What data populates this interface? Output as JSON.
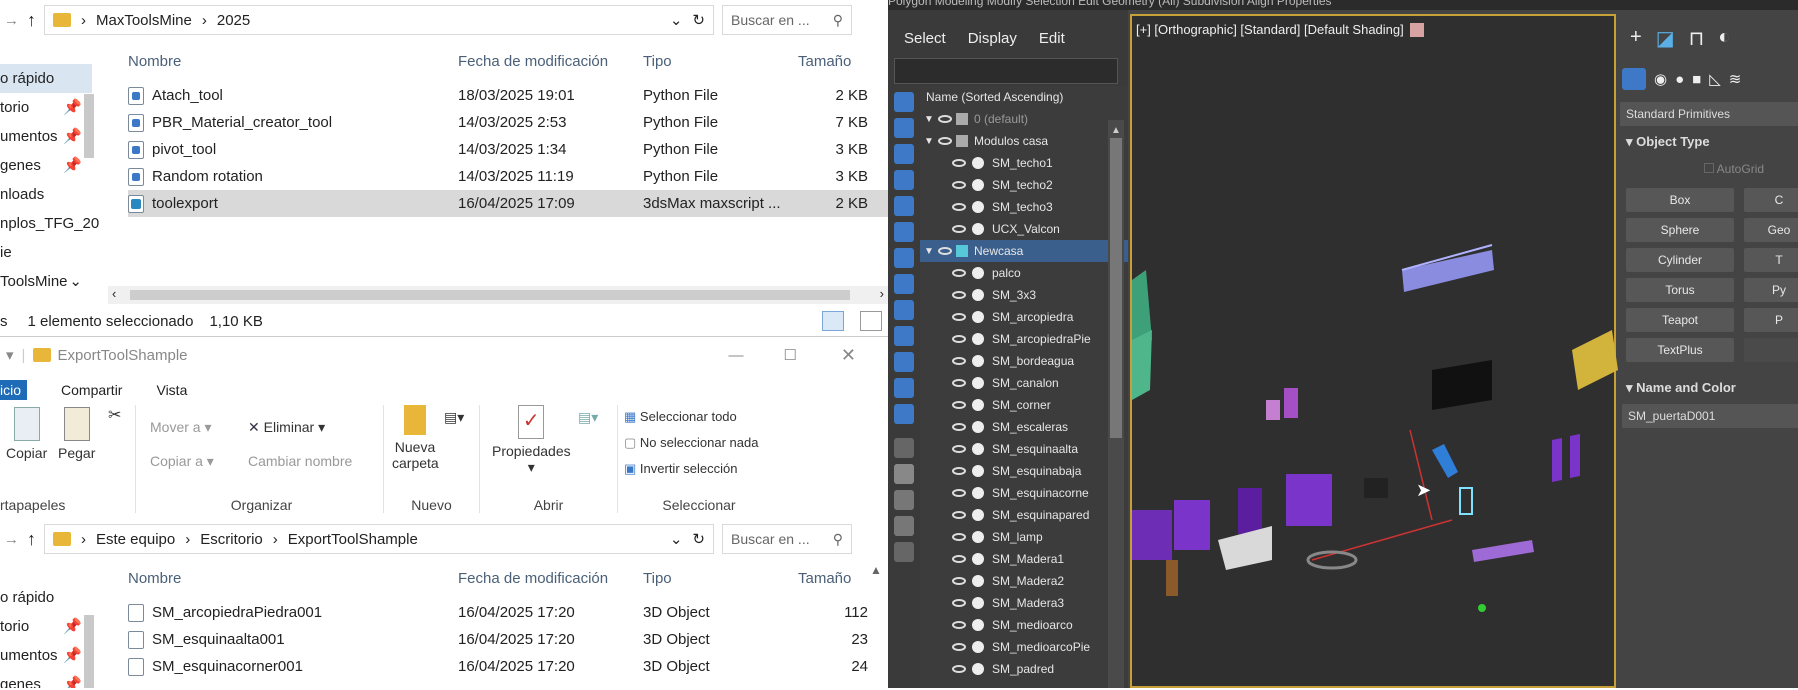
{
  "explorer_top": {
    "path": [
      "MaxToolsMine",
      "2025"
    ],
    "search_placeholder": "Buscar en ...",
    "nav": [
      {
        "label": "o rápido",
        "pin": false
      },
      {
        "label": "torio",
        "pin": true
      },
      {
        "label": "umentos",
        "pin": true
      },
      {
        "label": "genes",
        "pin": true
      },
      {
        "label": "nloads",
        "pin": false
      },
      {
        "label": "nplos_TFG_20",
        "pin": false
      },
      {
        "label": "ie",
        "pin": false
      },
      {
        "label": "ToolsMine",
        "pin": false
      }
    ],
    "columns": {
      "name": "Nombre",
      "date": "Fecha de modificación",
      "type": "Tipo",
      "size": "Tamaño"
    },
    "files": [
      {
        "name": "Atach_tool",
        "date": "18/03/2025 19:01",
        "type": "Python File",
        "size": "2 KB",
        "icon": "py"
      },
      {
        "name": "PBR_Material_creator_tool",
        "date": "14/03/2025 2:53",
        "type": "Python File",
        "size": "7 KB",
        "icon": "py"
      },
      {
        "name": "pivot_tool",
        "date": "14/03/2025 1:34",
        "type": "Python File",
        "size": "3 KB",
        "icon": "py"
      },
      {
        "name": "Random rotation",
        "date": "14/03/2025 11:19",
        "type": "Python File",
        "size": "3 KB",
        "icon": "py"
      },
      {
        "name": "toolexport",
        "date": "16/04/2025 17:09",
        "type": "3dsMax maxscript ...",
        "size": "2 KB",
        "icon": "ms",
        "selected": true
      }
    ],
    "status_count": "s",
    "status_sel": "1 elemento seleccionado",
    "status_size": "1,10 KB"
  },
  "explorer_bottom": {
    "title": "ExportToolShample",
    "tabs": [
      "icio",
      "Compartir",
      "Vista"
    ],
    "ribbon": {
      "copy": "Copiar",
      "paste": "Pegar",
      "clipboard": "rtapapeles",
      "move_to": "Mover a",
      "copy_to": "Copiar a",
      "delete": "Eliminar",
      "rename": "Cambiar nombre",
      "organize": "Organizar",
      "new_folder": "Nueva carpeta",
      "new": "Nuevo",
      "properties": "Propiedades",
      "open": "Abrir",
      "select_all": "Seleccionar todo",
      "select_none": "No seleccionar nada",
      "invert": "Invertir selección",
      "select": "Seleccionar"
    },
    "path": [
      "Este equipo",
      "Escritorio",
      "ExportToolShample"
    ],
    "search_placeholder": "Buscar en ...",
    "nav": [
      {
        "label": "o rápido",
        "pin": false
      },
      {
        "label": "torio",
        "pin": true
      },
      {
        "label": "umentos",
        "pin": true
      },
      {
        "label": "genes",
        "pin": true
      }
    ],
    "columns": {
      "name": "Nombre",
      "date": "Fecha de modificación",
      "type": "Tipo",
      "size": "Tamaño"
    },
    "files": [
      {
        "name": "SM_arcopiedraPiedra001",
        "date": "16/04/2025 17:20",
        "type": "3D Object",
        "size": "112"
      },
      {
        "name": "SM_esquinaalta001",
        "date": "16/04/2025 17:20",
        "type": "3D Object",
        "size": "23"
      },
      {
        "name": "SM_esquinacorner001",
        "date": "16/04/2025 17:20",
        "type": "3D Object",
        "size": "24"
      }
    ]
  },
  "max": {
    "menubar": "Polygon Modeling   Modify Selection   Edit   Geometry (All)   Subdivision   Align   Properties",
    "scene_menu": [
      "Select",
      "Display",
      "Edit"
    ],
    "scene_header": "Name (Sorted Ascending)",
    "scene_rows": [
      {
        "label": "0 (default)",
        "level": 0,
        "kind": "layer",
        "dim": true
      },
      {
        "label": "Modulos casa",
        "level": 0,
        "kind": "layer"
      },
      {
        "label": "SM_techo1",
        "level": 1,
        "kind": "obj"
      },
      {
        "label": "SM_techo2",
        "level": 1,
        "kind": "obj"
      },
      {
        "label": "SM_techo3",
        "level": 1,
        "kind": "obj"
      },
      {
        "label": "UCX_Valcon",
        "level": 1,
        "kind": "obj"
      },
      {
        "label": "Newcasa",
        "level": 0,
        "kind": "layer",
        "selected": true
      },
      {
        "label": "palco",
        "level": 1,
        "kind": "obj"
      },
      {
        "label": "SM_3x3",
        "level": 1,
        "kind": "obj"
      },
      {
        "label": "SM_arcopiedra",
        "level": 1,
        "kind": "obj"
      },
      {
        "label": "SM_arcopiedraPie",
        "level": 1,
        "kind": "obj"
      },
      {
        "label": "SM_bordeagua",
        "level": 1,
        "kind": "obj"
      },
      {
        "label": "SM_canalon",
        "level": 1,
        "kind": "obj"
      },
      {
        "label": "SM_corner",
        "level": 1,
        "kind": "obj"
      },
      {
        "label": "SM_escaleras",
        "level": 1,
        "kind": "obj"
      },
      {
        "label": "SM_esquinaalta",
        "level": 1,
        "kind": "obj"
      },
      {
        "label": "SM_esquinabaja",
        "level": 1,
        "kind": "obj"
      },
      {
        "label": "SM_esquinacorne",
        "level": 1,
        "kind": "obj"
      },
      {
        "label": "SM_esquinapared",
        "level": 1,
        "kind": "obj"
      },
      {
        "label": "SM_lamp",
        "level": 1,
        "kind": "obj"
      },
      {
        "label": "SM_Madera1",
        "level": 1,
        "kind": "obj"
      },
      {
        "label": "SM_Madera2",
        "level": 1,
        "kind": "obj"
      },
      {
        "label": "SM_Madera3",
        "level": 1,
        "kind": "obj"
      },
      {
        "label": "SM_medioarco",
        "level": 1,
        "kind": "obj"
      },
      {
        "label": "SM_medioarcoPie",
        "level": 1,
        "kind": "obj"
      },
      {
        "label": "SM_padred",
        "level": 1,
        "kind": "obj"
      }
    ],
    "viewport_label": "[+] [Orthographic] [Standard] [Default Shading]",
    "cmd": {
      "dropdown": "Standard Primitives",
      "object_type": "Object Type",
      "autogrid": "AutoGrid",
      "buttons": [
        "Box",
        "C",
        "Sphere",
        "Geo",
        "Cylinder",
        "T",
        "Torus",
        "Py",
        "Teapot",
        "P",
        "TextPlus",
        ""
      ],
      "name_color": "Name and Color",
      "name_value": "SM_puertaD001"
    }
  }
}
